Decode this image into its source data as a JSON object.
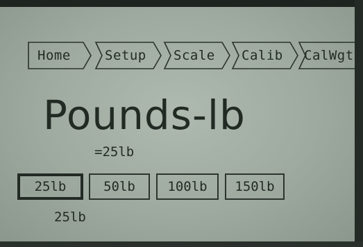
{
  "breadcrumbs": [
    {
      "label": "Home"
    },
    {
      "label": "Setup"
    },
    {
      "label": "Scale"
    },
    {
      "label": "Calib"
    },
    {
      "label": "CalWgt"
    }
  ],
  "title": "Pounds-lb",
  "readout": "=25lb",
  "weights": [
    {
      "label": "25lb",
      "selected": true
    },
    {
      "label": "50lb",
      "selected": false
    },
    {
      "label": "100lb",
      "selected": false
    },
    {
      "label": "150lb",
      "selected": false
    }
  ],
  "selected_label": "25lb",
  "colors": {
    "lcd_background": "#a6b2a7",
    "lcd_ink": "#222a24",
    "bezel": "#1e2420"
  }
}
